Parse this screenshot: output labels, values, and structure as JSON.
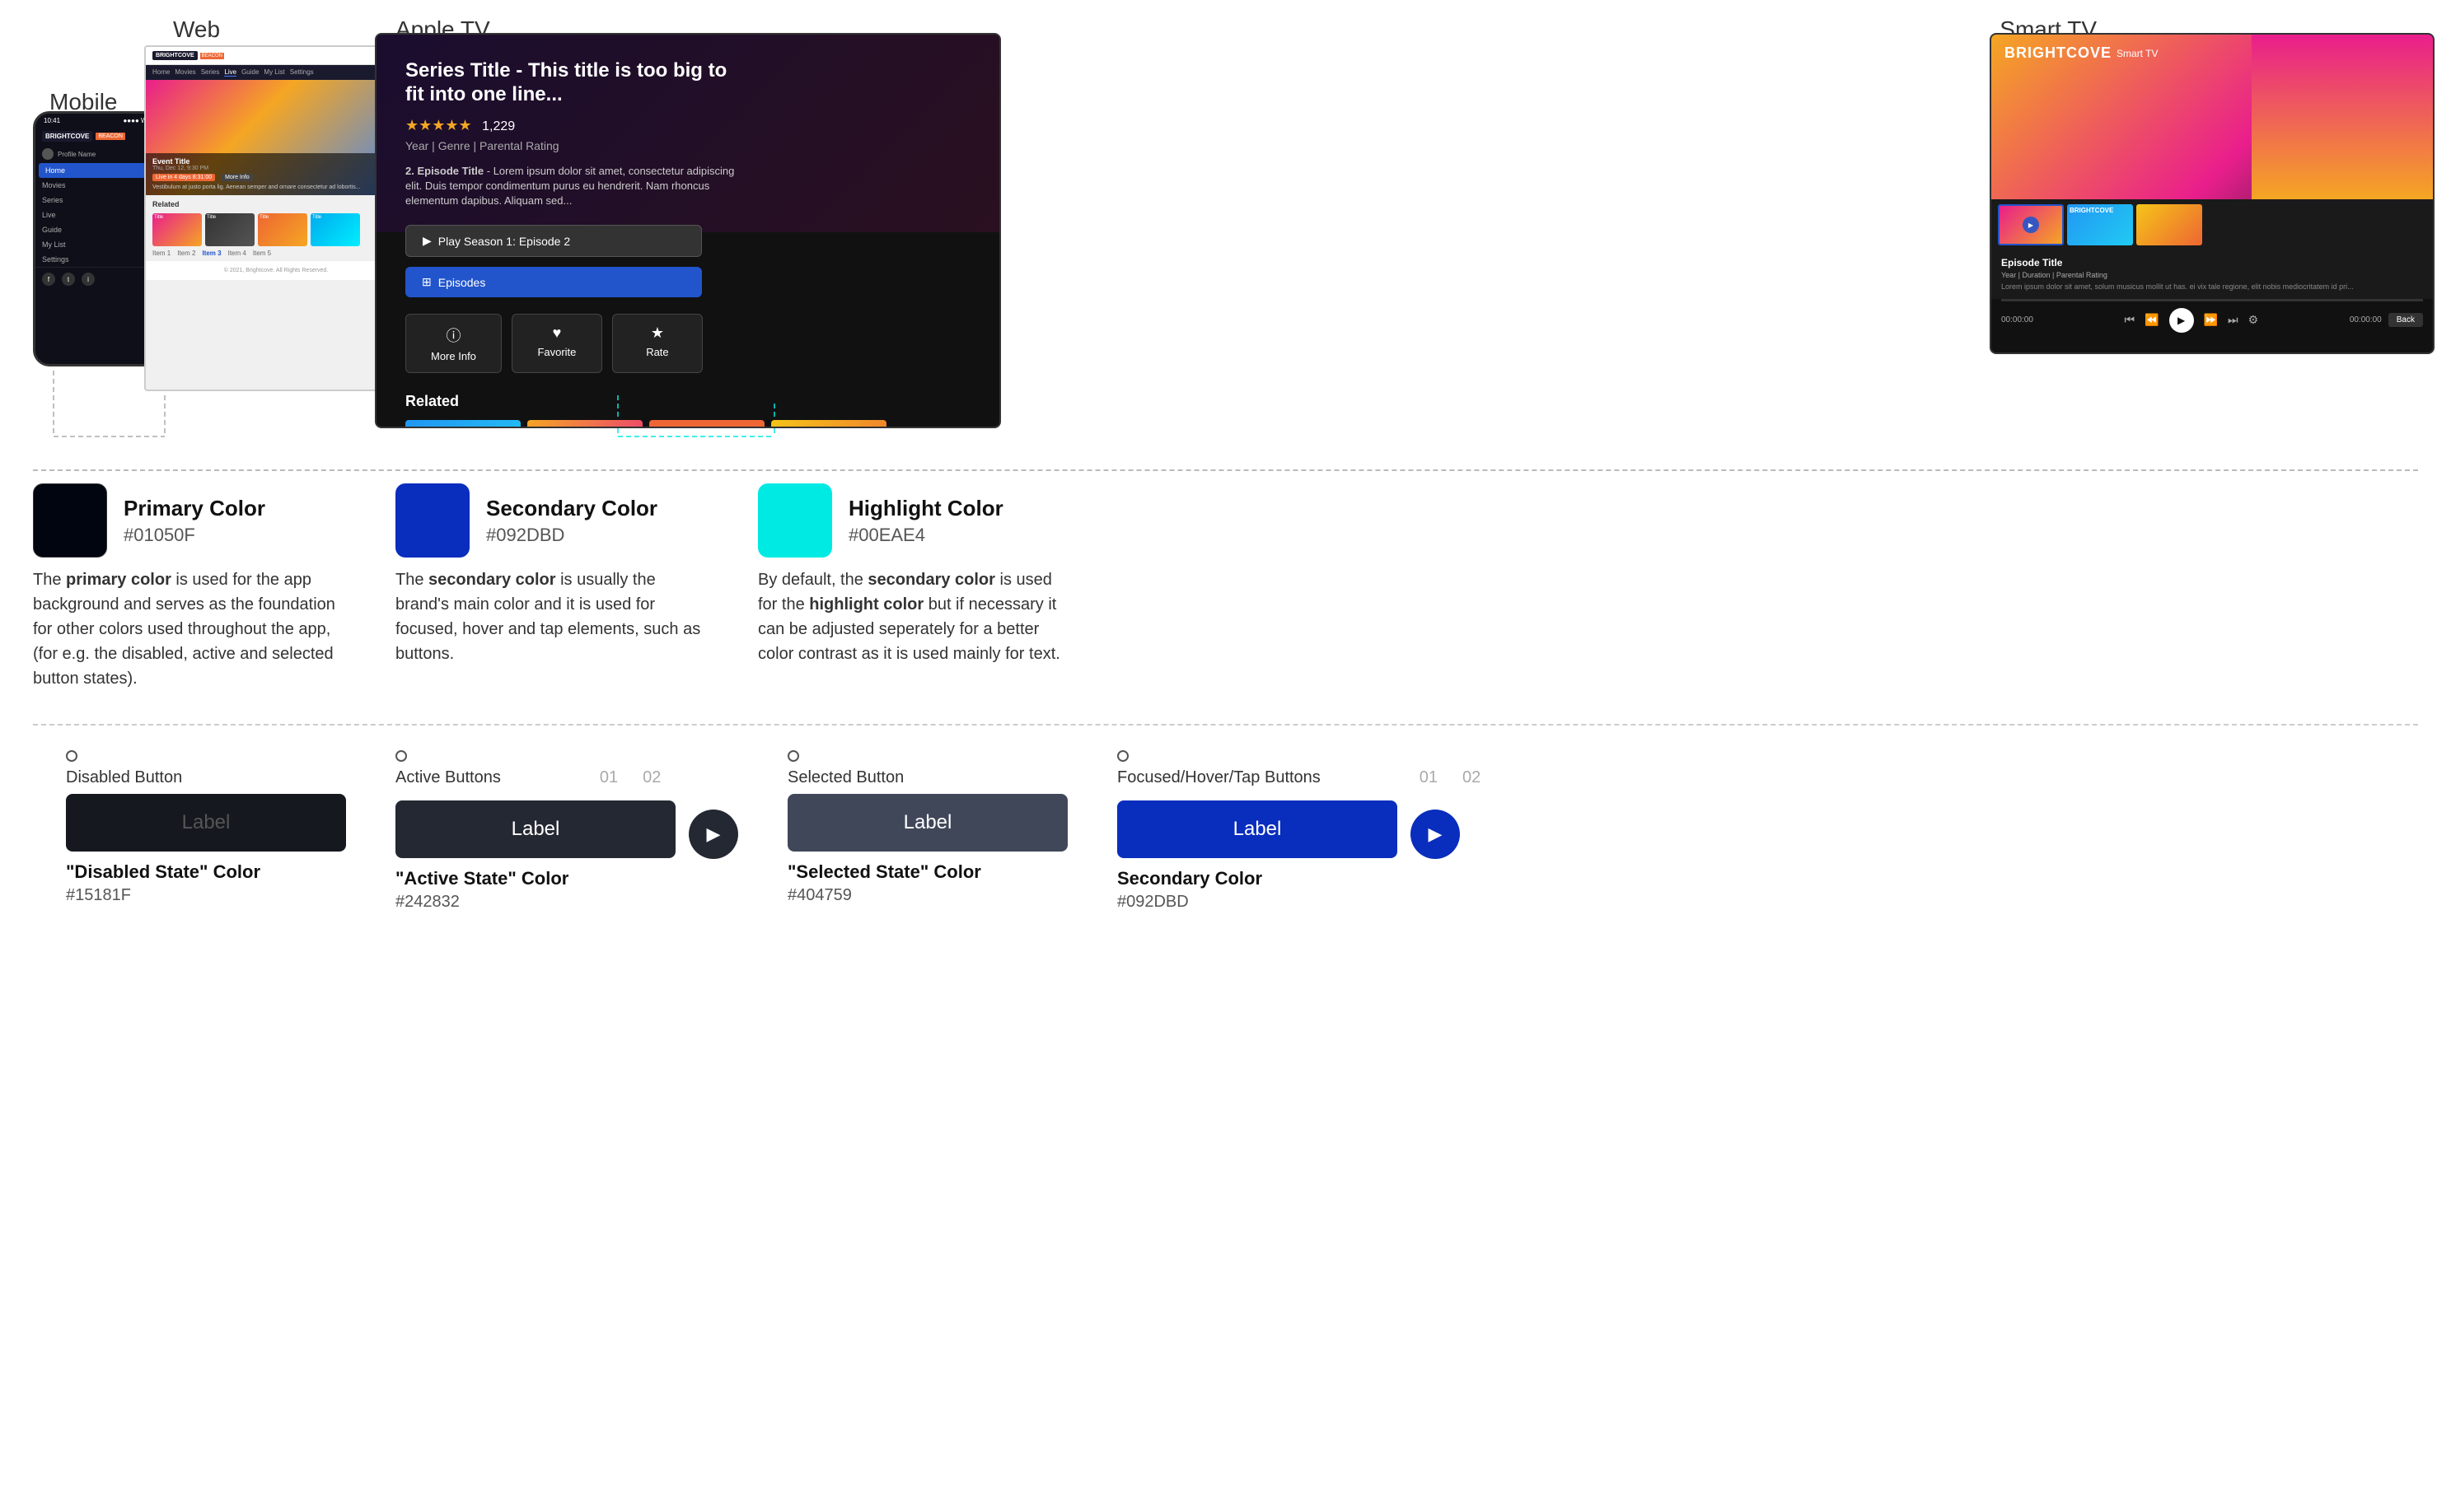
{
  "labels": {
    "web": "Web",
    "mobile": "Mobile",
    "appletv": "Apple TV",
    "smarttv": "Smart TV"
  },
  "mobile": {
    "time": "10:41",
    "logo": "BRIGHTCOVE",
    "beacon": "BEACON",
    "profile": "Profile Name",
    "nav": [
      "Home",
      "Movies",
      "Series",
      "Live",
      "Guide",
      "My List",
      "Settings"
    ]
  },
  "web": {
    "logo": "BRIGHTCOVE",
    "beacon": "BEACON",
    "nav": [
      "Home",
      "Movies",
      "Series",
      "Live",
      "Guide",
      "My List",
      "Settings"
    ],
    "event_title": "Event Title",
    "event_date": "Thu, Dec 12, 9:30 PM",
    "live_label": "Live in 4 days 8:31:00",
    "more_info": "More Info",
    "related": "Related",
    "footer": "© 2021, Brightcove. All Rights Reserved.",
    "items": [
      "Item 1",
      "Item 2",
      "Item 3",
      "Item 4",
      "Item 5"
    ]
  },
  "appletv": {
    "title": "Series Title - This title is too big to fit into one line...",
    "stars": "★★★★★",
    "rating_count": "1,229",
    "meta": "Year | Genre | Parental Rating",
    "episode_label": "2. Episode Title",
    "episode_desc": "Lorem ipsum dolor sit amet, consectetur adipiscing elit. Duis tempor condimentum purus eu hendrerit. Nam rhoncus elementum dapibus. Aliquam sed...",
    "play_btn": "Play Season 1: Episode 2",
    "episodes_btn": "Episodes",
    "more_info": "More Info",
    "favorite": "Favorite",
    "rate": "Rate",
    "related": "Related"
  },
  "smarttv": {
    "logo": "BRIGHTCOVE",
    "label": "Smart TV",
    "episode_title": "Episode Title",
    "episode_meta": "Year | Duration | Parental Rating",
    "episode_desc": "Lorem ipsum dolor sit amet, solum musicus mollit ut has. ei vix tale regione, elit nobis mediocritatem id pri...",
    "time_start": "00:00:00",
    "time_end": "00:00:00",
    "back": "Back"
  },
  "colors": {
    "primary": {
      "name": "Primary Color",
      "hex": "#01050F",
      "swatch": "#01050F",
      "description_parts": {
        "pre": "The ",
        "bold": "primary color",
        "post": " is used for the app background and serves as the foundation for other colors used throughout the app, (for e.g. the disabled, active and selected button states)."
      }
    },
    "secondary": {
      "name": "Secondary Color",
      "hex": "#092DBD",
      "swatch": "#092DBD",
      "description_parts": {
        "pre": "The ",
        "bold": "secondary color",
        "post": " is usually the brand's main color and it is used for focused, hover and tap elements, such as buttons."
      }
    },
    "highlight": {
      "name": "Highlight Color",
      "hex": "#00EAE4",
      "swatch": "#00EAE4",
      "description_parts": {
        "pre": "By default, the ",
        "bold": "secondary color",
        "post_pre": " is used for the ",
        "bold2": "highlight color",
        "post": " but if necessary it can be adjusted seperately for a better color contrast as it is used mainly for text."
      }
    }
  },
  "buttons": {
    "disabled": {
      "state_label": "Disabled Button",
      "btn_label": "Label",
      "color_name": "\"Disabled State\" Color",
      "color_hex": "#15181F"
    },
    "active": {
      "state_label": "Active Buttons",
      "btn_label": "Label",
      "color_name": "\"Active State\" Color",
      "color_hex": "#242832",
      "num1": "01",
      "num2": "02"
    },
    "selected": {
      "state_label": "Selected Button",
      "btn_label": "Label",
      "color_name": "\"Selected State\" Color",
      "color_hex": "#404759"
    },
    "focused": {
      "state_label": "Focused/Hover/Tap Buttons",
      "btn_label": "Label",
      "color_name": "Secondary Color",
      "color_hex": "#092DBD",
      "num1": "01",
      "num2": "02"
    }
  }
}
